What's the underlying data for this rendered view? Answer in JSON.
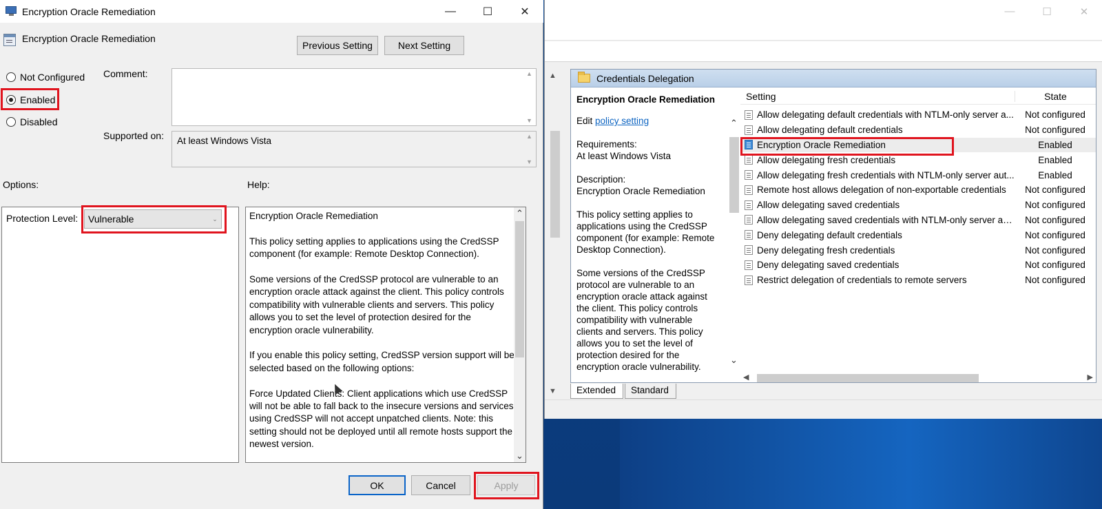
{
  "back_window": {
    "header_title": "Credentials Delegation",
    "description": {
      "title": "Encryption Oracle Remediation",
      "edit_prefix": "Edit",
      "edit_link": "policy setting",
      "requirements_label": "Requirements:",
      "requirements_value": "At least Windows Vista",
      "description_label": "Description:",
      "description_value": "Encryption Oracle Remediation",
      "para1": "This policy setting applies to applications using the CredSSP component (for example: Remote Desktop Connection).",
      "para2": "Some versions of the CredSSP protocol are vulnerable to an encryption oracle attack against the client.  This policy controls compatibility with vulnerable clients and servers.  This policy allows you to set the level of protection desired for the encryption oracle vulnerability."
    },
    "columns": {
      "setting": "Setting",
      "state": "State"
    },
    "settings": [
      {
        "name": "Allow delegating default credentials with NTLM-only server a...",
        "state": "Not configured"
      },
      {
        "name": "Allow delegating default credentials",
        "state": "Not configured"
      },
      {
        "name": "Encryption Oracle Remediation",
        "state": "Enabled"
      },
      {
        "name": "Allow delegating fresh credentials",
        "state": "Enabled"
      },
      {
        "name": "Allow delegating fresh credentials with NTLM-only server aut...",
        "state": "Enabled"
      },
      {
        "name": "Remote host allows delegation of non-exportable credentials",
        "state": "Not configured"
      },
      {
        "name": "Allow delegating saved credentials",
        "state": "Not configured"
      },
      {
        "name": "Allow delegating saved credentials with NTLM-only server au...",
        "state": "Not configured"
      },
      {
        "name": "Deny delegating default credentials",
        "state": "Not configured"
      },
      {
        "name": "Deny delegating fresh credentials",
        "state": "Not configured"
      },
      {
        "name": "Deny delegating saved credentials",
        "state": "Not configured"
      },
      {
        "name": "Restrict delegation of credentials to remote servers",
        "state": "Not configured"
      }
    ],
    "tabs": [
      "Extended",
      "Standard"
    ]
  },
  "dialog": {
    "title": "Encryption Oracle Remediation",
    "policy_name": "Encryption Oracle Remediation",
    "previous_setting": "Previous Setting",
    "next_setting": "Next Setting",
    "radio_not_configured": "Not Configured",
    "radio_enabled": "Enabled",
    "radio_disabled": "Disabled",
    "selected_radio": "Enabled",
    "comment_label": "Comment:",
    "comment_value": "",
    "supported_on_label": "Supported on:",
    "supported_on_value": "At least Windows Vista",
    "options_label": "Options:",
    "help_label": "Help:",
    "protection_level_label": "Protection Level:",
    "protection_level_value": "Vulnerable",
    "help_text": {
      "p1": "Encryption Oracle Remediation",
      "p2": "This policy setting applies to applications using the CredSSP component (for example: Remote Desktop Connection).",
      "p3": "Some versions of the CredSSP protocol are vulnerable to an encryption oracle attack against the client.  This policy controls compatibility with vulnerable clients and servers.  This policy allows you to set the level of protection desired for the encryption oracle vulnerability.",
      "p4": "If you enable this policy setting, CredSSP version support will be selected based on the following options:",
      "p5": "Force Updated Clients: Client applications which use CredSSP will not be able to fall back to the insecure versions and services using CredSSP will not accept unpatched clients. Note: this setting should not be deployed until all remote hosts support the newest version."
    },
    "ok": "OK",
    "cancel": "Cancel",
    "apply": "Apply"
  },
  "colors": {
    "highlight_red": "#e0141e",
    "link_blue": "#0b63c1",
    "desktop_blue": "#0a3d80"
  }
}
